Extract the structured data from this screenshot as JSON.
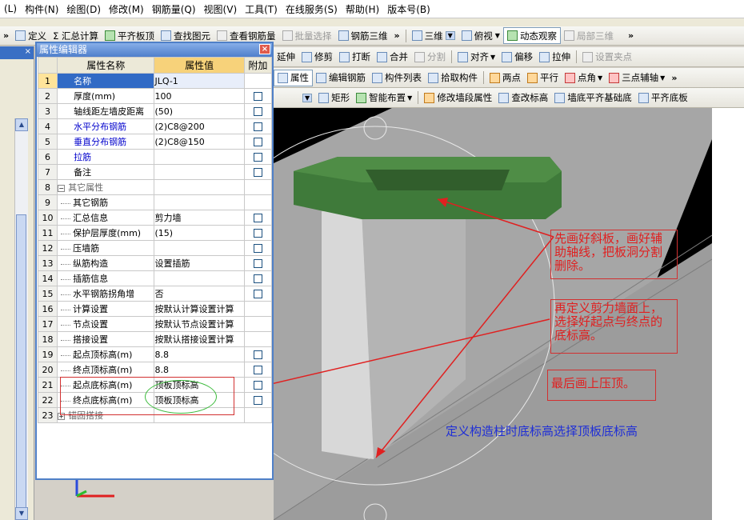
{
  "menu": [
    "(L)",
    "构件(N)",
    "绘图(D)",
    "修改(M)",
    "钢筋量(Q)",
    "视图(V)",
    "工具(T)",
    "在线服务(S)",
    "帮助(H)",
    "版本号(B)"
  ],
  "toolbar1": {
    "chevron": "»",
    "items": [
      "定义",
      "Σ 汇总计算",
      "平齐板顶",
      "查找图元",
      "查看钢筋量",
      "批量选择",
      "钢筋三维"
    ],
    "chevron2": "»",
    "view_items": [
      "三维",
      "俯视",
      "动态观察",
      "局部三维"
    ],
    "chevron3": "»"
  },
  "toolbar2": {
    "items": [
      "延伸",
      "修剪",
      "打断",
      "合并",
      "分割",
      "对齐",
      "偏移",
      "拉伸",
      "设置夹点"
    ]
  },
  "toolbar3a": {
    "items": [
      "属性",
      "编辑钢筋",
      "构件列表",
      "拾取构件",
      "两点",
      "平行",
      "点角",
      "三点辅轴"
    ],
    "chevron": "»"
  },
  "toolbar3b": {
    "items": [
      "矩形",
      "智能布置",
      "修改墙段属性",
      "查改标高",
      "墙底平齐基础底",
      "平齐底板"
    ]
  },
  "left_dock": {
    "tab_label": "×"
  },
  "property_editor": {
    "title": "属性编辑器",
    "headers": {
      "name": "属性名称",
      "value": "属性值",
      "extra": "附加"
    },
    "rows": [
      {
        "num": "1",
        "name": "名称",
        "value": "JLQ-1",
        "style": "selected",
        "check": false
      },
      {
        "num": "2",
        "name": "厚度(mm)",
        "value": "100",
        "style": "normal",
        "check": true
      },
      {
        "num": "3",
        "name": "轴线距左墙皮距离",
        "value": "(50)",
        "style": "normal",
        "check": true
      },
      {
        "num": "4",
        "name": "水平分布钢筋",
        "value": "(2)C8@200",
        "style": "blue",
        "check": true
      },
      {
        "num": "5",
        "name": "垂直分布钢筋",
        "value": "(2)C8@150",
        "style": "blue",
        "check": true
      },
      {
        "num": "6",
        "name": "拉筋",
        "value": "",
        "style": "blue",
        "check": true
      },
      {
        "num": "7",
        "name": "备注",
        "value": "",
        "style": "normal",
        "check": true
      },
      {
        "num": "8",
        "name": "其它属性",
        "value": "",
        "style": "group",
        "check": false
      },
      {
        "num": "9",
        "name": "其它钢筋",
        "value": "",
        "style": "child",
        "check": false
      },
      {
        "num": "10",
        "name": "汇总信息",
        "value": "剪力墙",
        "style": "child",
        "check": true
      },
      {
        "num": "11",
        "name": "保护层厚度(mm)",
        "value": "(15)",
        "style": "child",
        "check": true
      },
      {
        "num": "12",
        "name": "压墙筋",
        "value": "",
        "style": "child",
        "check": true
      },
      {
        "num": "13",
        "name": "纵筋构造",
        "value": "设置插筋",
        "style": "child",
        "check": true
      },
      {
        "num": "14",
        "name": "插筋信息",
        "value": "",
        "style": "child",
        "check": true
      },
      {
        "num": "15",
        "name": "水平钢筋拐角增",
        "value": "否",
        "style": "child",
        "check": true
      },
      {
        "num": "16",
        "name": "计算设置",
        "value": "按默认计算设置计算",
        "style": "child",
        "check": false
      },
      {
        "num": "17",
        "name": "节点设置",
        "value": "按默认节点设置计算",
        "style": "child",
        "check": false
      },
      {
        "num": "18",
        "name": "搭接设置",
        "value": "按默认搭接设置计算",
        "style": "child",
        "check": false
      },
      {
        "num": "19",
        "name": "起点顶标高(m)",
        "value": "8.8",
        "style": "child",
        "check": true
      },
      {
        "num": "20",
        "name": "终点顶标高(m)",
        "value": "8.8",
        "style": "child",
        "check": true
      },
      {
        "num": "21",
        "name": "起点底标高(m)",
        "value": "顶板顶标高",
        "style": "child",
        "check": true
      },
      {
        "num": "22",
        "name": "终点底标高(m)",
        "value": "顶板顶标高",
        "style": "child",
        "check": true
      },
      {
        "num": "23",
        "name": "锚固搭接",
        "value": "",
        "style": "group-collapsed",
        "check": false
      }
    ]
  },
  "annotations": {
    "note1": "先画好斜板，画好辅助轴线，把板洞分割删除。",
    "note2": "再定义剪力墙面上，选择好起点与终点的底标高。",
    "note3": "最后画上压顶。",
    "note4": "定义构造柱时底标高选择顶板底标高"
  },
  "colors": {
    "accent_blue": "#316ac5",
    "header_value": "#f7d27a",
    "annotation_red": "#e02020",
    "annotation_blue": "#1f2fd6",
    "beam_green": "#3f7a3a"
  }
}
